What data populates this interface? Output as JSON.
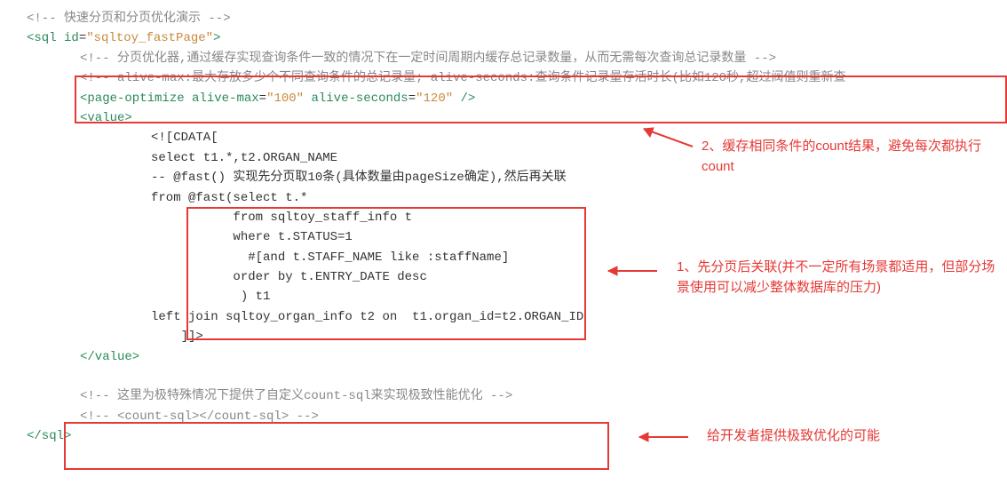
{
  "code": {
    "l1": "<!-- 快速分页和分页优化演示 -->",
    "l2a": "<sql ",
    "l2b": "id",
    "l2c": "=",
    "l2d": "\"sqltoy_fastPage\"",
    "l2e": ">",
    "l3": "<!-- 分页优化器,通过缓存实现查询条件一致的情况下在一定时间周期内缓存总记录数量，从而无需每次查询总记录数量 -->",
    "l4": "<!-- alive-max:最大存放多少个不同查询条件的总记录量; alive-seconds:查询条件记录量存活时长(比如120秒,超过阀值则重新查",
    "l5a": "<page-optimize ",
    "l5b": "alive-max",
    "l5c": "=",
    "l5d": "\"100\"",
    "l5e": " alive-seconds",
    "l5f": "=",
    "l5g": "\"120\"",
    "l5h": " />",
    "l6": "<value>",
    "l7": "<![CDATA[",
    "l8": "select t1.*,t2.ORGAN_NAME",
    "l9": "-- @fast() 实现先分页取10条(具体数量由pageSize确定),然后再关联",
    "l10": "from @fast(select t.*",
    "l11": "           from sqltoy_staff_info t",
    "l12": "           where t.STATUS=1",
    "l13": "             #[and t.STAFF_NAME like :staffName]",
    "l14": "           order by t.ENTRY_DATE desc",
    "l15": "            ) t1",
    "l16": "left join sqltoy_organ_info t2 on  t1.organ_id=t2.ORGAN_ID",
    "l17": "    ]]>",
    "l18": "</value>",
    "l19": "<!-- 这里为极特殊情况下提供了自定义count-sql来实现极致性能优化 -->",
    "l20": "<!-- <count-sql></count-sql> -->",
    "l21": "</sql>"
  },
  "annotations": {
    "a1": "2、缓存相同条件的count结果，避免每次都执行count",
    "a2": "1、先分页后关联(并不一定所有场景都适用，但部分场景使用可以减少整体数据库的压力)",
    "a3": "给开发者提供极致优化的可能"
  }
}
